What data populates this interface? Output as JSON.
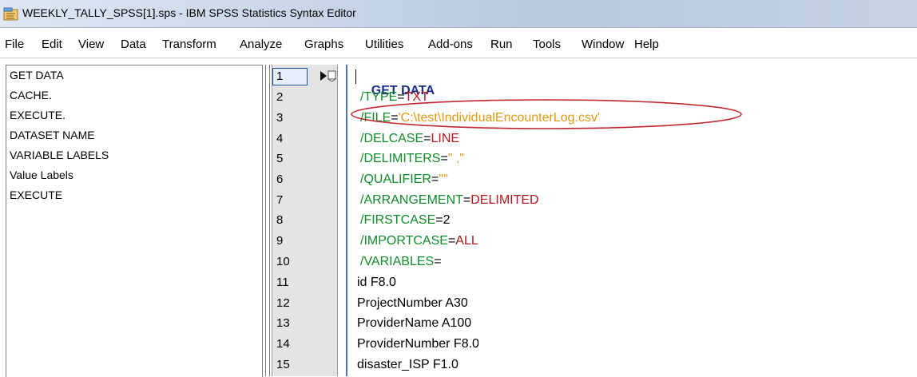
{
  "window": {
    "title": "WEEKLY_TALLY_SPSS[1].sps - IBM SPSS Statistics Syntax Editor",
    "icon": "spss-syntax-icon"
  },
  "menu": {
    "file": "File",
    "edit": "Edit",
    "view": "View",
    "data": "Data",
    "transform": "Transform",
    "analyze": "Analyze",
    "graphs": "Graphs",
    "utilities": "Utilities",
    "addons": "Add-ons",
    "run": "Run",
    "tools": "Tools",
    "window": "Window",
    "help": "Help"
  },
  "outline": {
    "items": [
      "GET DATA",
      "CACHE.",
      "EXECUTE.",
      "DATASET NAME",
      "VARIABLE LABELS",
      "Value Labels",
      "EXECUTE"
    ]
  },
  "editor": {
    "line_numbers": [
      "1",
      "2",
      "3",
      "4",
      "5",
      "6",
      "7",
      "8",
      "9",
      "10",
      "11",
      "12",
      "13",
      "14",
      "15"
    ],
    "lines": [
      {
        "kw": "GET DATA"
      },
      {
        "sub": "/TYPE",
        "eq": "=",
        "val": "TXT"
      },
      {
        "sub": "/FILE",
        "eq": "=",
        "str": "'C:\\test\\IndividualEncounterLog.csv'"
      },
      {
        "sub": "/DELCASE",
        "eq": "=",
        "val": "LINE"
      },
      {
        "sub": "/DELIMITERS",
        "eq": "=",
        "str": "\" ,\""
      },
      {
        "sub": "/QUALIFIER",
        "eq": "=",
        "str": "'\"'"
      },
      {
        "sub": "/ARRANGEMENT",
        "eq": "=",
        "val": "DELIMITED"
      },
      {
        "sub": "/FIRSTCASE",
        "eq": "=",
        "plain": "2"
      },
      {
        "sub": "/IMPORTCASE",
        "eq": "=",
        "val": "ALL"
      },
      {
        "sub": "/VARIABLES",
        "eq": "="
      },
      {
        "plain": "id F8.0"
      },
      {
        "plain": "ProjectNumber A30"
      },
      {
        "plain": "ProviderName A100"
      },
      {
        "plain": "ProviderNumber F8.0"
      },
      {
        "plain": "disaster_ISP F1.0"
      }
    ]
  },
  "colors": {
    "keyword": "#1a2e8a",
    "subcommand": "#0f8c2a",
    "value": "#b3171b",
    "string": "#e09a14",
    "annotation_oval": "#c0282d"
  }
}
